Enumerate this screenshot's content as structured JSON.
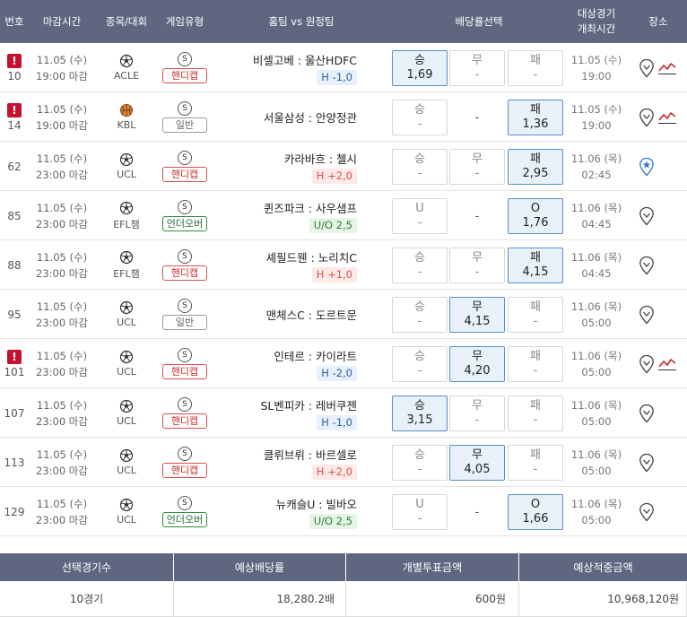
{
  "header": {
    "no": "번호",
    "deadline": "마감시간",
    "league": "종목/대회",
    "game_type": "게임유형",
    "teams": "홈팀 vs 원정팀",
    "odds": "배당률선택",
    "event_time_1": "대상경기",
    "event_time_2": "개최시간",
    "place": "장소"
  },
  "rows": [
    {
      "no": "10",
      "flag": "!",
      "date": "11.05 (수)",
      "time": "19:00 마감",
      "sport": "soccer",
      "league": "ACLE",
      "s": "S",
      "badge": "핸디캡",
      "badge_kind": "h",
      "home": "비셀고베",
      "away": "울산HDFC",
      "line": "H -1,0",
      "line_kind": "hb",
      "o1": {
        "label": "승",
        "val": "1,69",
        "sel": true
      },
      "o2": {
        "label": "무",
        "val": "-",
        "sel": false,
        "box": true
      },
      "o3": {
        "label": "패",
        "val": "-",
        "sel": false
      },
      "ed": "11.05 (수)",
      "et": "19:00",
      "place": "pin-trend"
    },
    {
      "no": "14",
      "flag": "!",
      "date": "11.05 (수)",
      "time": "19:00 마감",
      "sport": "basketball",
      "league": "KBL",
      "s": "S",
      "badge": "일반",
      "badge_kind": "g",
      "home": "서울삼성",
      "away": "안양정관",
      "line": "",
      "line_kind": "",
      "o1": {
        "label": "승",
        "val": "-",
        "sel": false
      },
      "o2": {
        "label": "-",
        "val": "",
        "sel": false,
        "box": false
      },
      "o3": {
        "label": "패",
        "val": "1,36",
        "sel": true
      },
      "ed": "11.05 (수)",
      "et": "19:00",
      "place": "pin-trend"
    },
    {
      "no": "62",
      "flag": "",
      "date": "11.05 (수)",
      "time": "23:00 마감",
      "sport": "soccer",
      "league": "UCL",
      "s": "S",
      "badge": "핸디캡",
      "badge_kind": "h",
      "home": "카라바흐",
      "away": "첼시",
      "line": "H +2,0",
      "line_kind": "h",
      "o1": {
        "label": "승",
        "val": "-",
        "sel": false
      },
      "o2": {
        "label": "무",
        "val": "-",
        "sel": false,
        "box": true
      },
      "o3": {
        "label": "패",
        "val": "2,95",
        "sel": true
      },
      "ed": "11.06 (목)",
      "et": "02:45",
      "place": "pin-star"
    },
    {
      "no": "85",
      "flag": "",
      "date": "11.05 (수)",
      "time": "23:00 마감",
      "sport": "soccer",
      "league": "EFL챔",
      "s": "S",
      "badge": "언더오버",
      "badge_kind": "u",
      "home": "퀸즈파크",
      "away": "사우샘프",
      "line": "U/O 2,5",
      "line_kind": "u",
      "o1": {
        "label": "U",
        "val": "-",
        "sel": false
      },
      "o2": {
        "label": "-",
        "val": "",
        "sel": false,
        "box": false
      },
      "o3": {
        "label": "O",
        "val": "1,76",
        "sel": true
      },
      "ed": "11.06 (목)",
      "et": "04:45",
      "place": "pin"
    },
    {
      "no": "88",
      "flag": "",
      "date": "11.05 (수)",
      "time": "23:00 마감",
      "sport": "soccer",
      "league": "EFL챔",
      "s": "S",
      "badge": "핸디캡",
      "badge_kind": "h",
      "home": "셰필드웬",
      "away": "노리치C",
      "line": "H +1,0",
      "line_kind": "h",
      "o1": {
        "label": "승",
        "val": "-",
        "sel": false
      },
      "o2": {
        "label": "무",
        "val": "-",
        "sel": false,
        "box": true
      },
      "o3": {
        "label": "패",
        "val": "4,15",
        "sel": true
      },
      "ed": "11.06 (목)",
      "et": "04:45",
      "place": "pin"
    },
    {
      "no": "95",
      "flag": "",
      "date": "11.05 (수)",
      "time": "23:00 마감",
      "sport": "soccer",
      "league": "UCL",
      "s": "S",
      "badge": "일반",
      "badge_kind": "g",
      "home": "맨체스C",
      "away": "도르트문",
      "line": "",
      "line_kind": "",
      "o1": {
        "label": "승",
        "val": "-",
        "sel": false
      },
      "o2": {
        "label": "무",
        "val": "4,15",
        "sel": true,
        "box": true
      },
      "o3": {
        "label": "패",
        "val": "-",
        "sel": false
      },
      "ed": "11.06 (목)",
      "et": "05:00",
      "place": "pin"
    },
    {
      "no": "101",
      "flag": "!",
      "date": "11.05 (수)",
      "time": "23:00 마감",
      "sport": "soccer",
      "league": "UCL",
      "s": "S",
      "badge": "핸디캡",
      "badge_kind": "h",
      "home": "인테르",
      "away": "카이라트",
      "line": "H -2,0",
      "line_kind": "hb",
      "o1": {
        "label": "승",
        "val": "-",
        "sel": false
      },
      "o2": {
        "label": "무",
        "val": "4,20",
        "sel": true,
        "box": true
      },
      "o3": {
        "label": "패",
        "val": "-",
        "sel": false
      },
      "ed": "11.06 (목)",
      "et": "05:00",
      "place": "pin-trend"
    },
    {
      "no": "107",
      "flag": "",
      "date": "11.05 (수)",
      "time": "23:00 마감",
      "sport": "soccer",
      "league": "UCL",
      "s": "S",
      "badge": "핸디캡",
      "badge_kind": "h",
      "home": "SL벤피카",
      "away": "레버쿠젠",
      "line": "H -1,0",
      "line_kind": "hb",
      "o1": {
        "label": "승",
        "val": "3,15",
        "sel": true
      },
      "o2": {
        "label": "무",
        "val": "-",
        "sel": false,
        "box": true
      },
      "o3": {
        "label": "패",
        "val": "-",
        "sel": false
      },
      "ed": "11.06 (목)",
      "et": "05:00",
      "place": "pin"
    },
    {
      "no": "113",
      "flag": "",
      "date": "11.05 (수)",
      "time": "23:00 마감",
      "sport": "soccer",
      "league": "UCL",
      "s": "S",
      "badge": "핸디캡",
      "badge_kind": "h",
      "home": "클뤼브뤼",
      "away": "바르셀로",
      "line": "H +2,0",
      "line_kind": "h",
      "o1": {
        "label": "승",
        "val": "-",
        "sel": false
      },
      "o2": {
        "label": "무",
        "val": "4,05",
        "sel": true,
        "box": true
      },
      "o3": {
        "label": "패",
        "val": "-",
        "sel": false
      },
      "ed": "11.06 (목)",
      "et": "05:00",
      "place": "pin"
    },
    {
      "no": "129",
      "flag": "",
      "date": "11.05 (수)",
      "time": "23:00 마감",
      "sport": "soccer",
      "league": "UCL",
      "s": "S",
      "badge": "언더오버",
      "badge_kind": "u",
      "home": "뉴캐슬U",
      "away": "빌바오",
      "line": "U/O 2,5",
      "line_kind": "u",
      "o1": {
        "label": "U",
        "val": "-",
        "sel": false
      },
      "o2": {
        "label": "-",
        "val": "",
        "sel": false,
        "box": false
      },
      "o3": {
        "label": "O",
        "val": "1,66",
        "sel": true
      },
      "ed": "11.06 (목)",
      "et": "05:00",
      "place": "pin"
    }
  ],
  "summary": {
    "h1": "선택경기수",
    "h2": "예상배당률",
    "h3": "개별투표금액",
    "h4": "예상적중금액",
    "v1": "10경기",
    "v2": "18,280.2배",
    "v3": "600원",
    "v4": "10,968,120원"
  },
  "colors": {
    "header_bg": "#5f6780",
    "selected_bg": "#e8f1fa",
    "selected_border": "#5a8ec8",
    "flag": "#c8102e",
    "handicap": "#d9534f",
    "underover": "#2e8b3a"
  }
}
